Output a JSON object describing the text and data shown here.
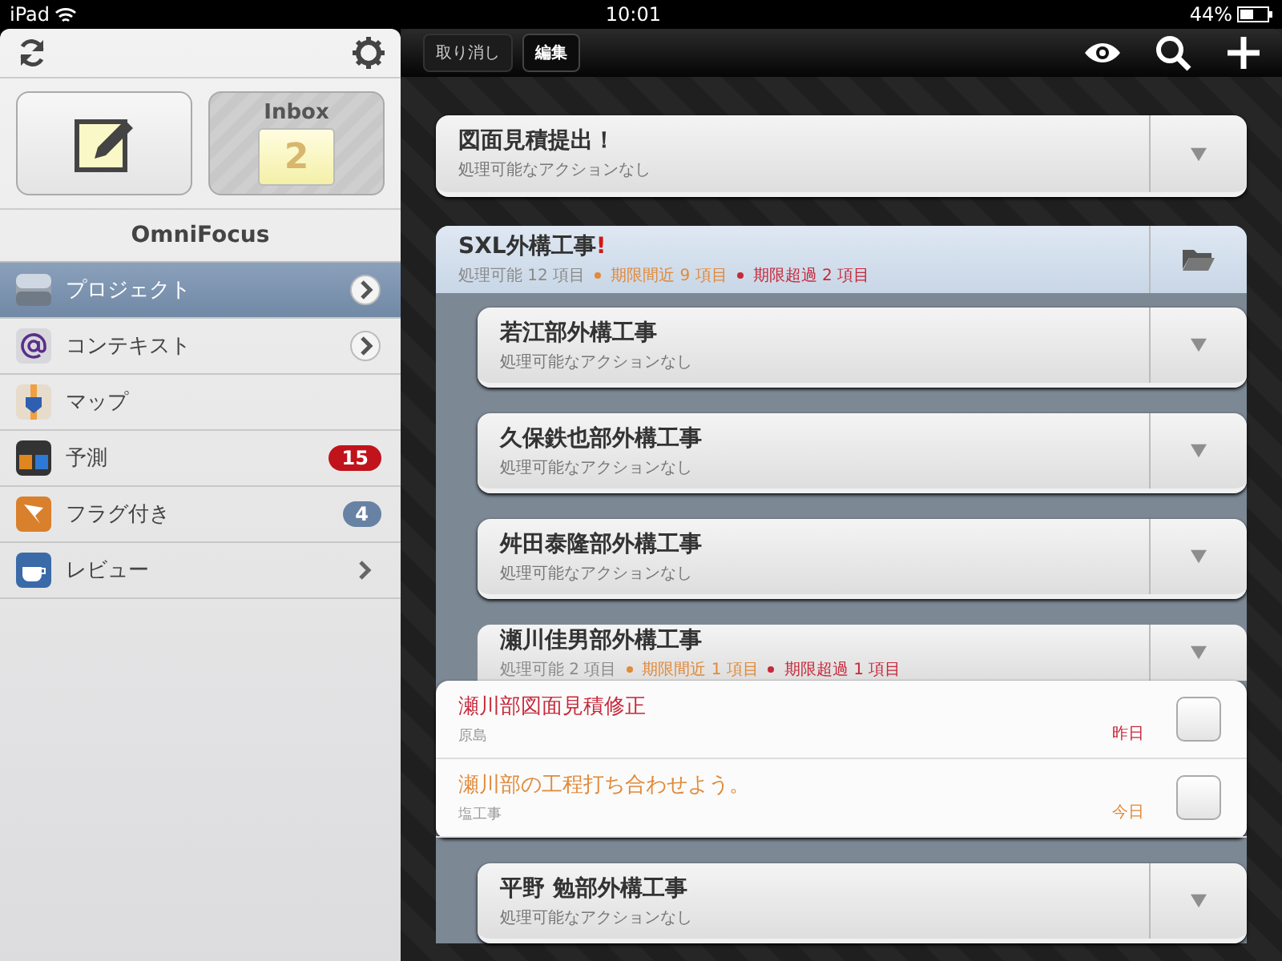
{
  "status_bar": {
    "carrier": "iPad",
    "time": "10:01",
    "battery": "44%"
  },
  "sidebar": {
    "title": "OmniFocus",
    "inbox": {
      "label": "Inbox",
      "count": "2"
    },
    "items": [
      {
        "kind": "projects",
        "label": "プロジェクト",
        "selected": true,
        "detail_button": true
      },
      {
        "kind": "contexts",
        "label": "コンテキスト",
        "selected": false,
        "detail_button": true
      },
      {
        "kind": "map",
        "label": "マップ",
        "selected": false
      },
      {
        "kind": "forecast",
        "label": "予測",
        "selected": false,
        "badge": "15",
        "color": "#c0131c"
      },
      {
        "kind": "flagged",
        "label": "フラグ付き",
        "selected": false,
        "badge": "4",
        "color": "#6882a4"
      },
      {
        "kind": "review",
        "label": "レビュー",
        "selected": false,
        "disclosure": true
      }
    ]
  },
  "toolbar": {
    "buttons": [
      {
        "label": "取り消し",
        "selected": false
      },
      {
        "label": "編集",
        "selected": true
      }
    ]
  },
  "content": [
    {
      "kind": "project",
      "title": "図面見積提出！",
      "subtitle": "処理可能なアクションなし"
    },
    {
      "kind": "folder",
      "title": "SXL外構工事",
      "priority_mark": "!",
      "meta": [
        {
          "text": "処理可能 12 項目",
          "color": "#8a8a8a"
        },
        {
          "text": "期限間近 9 項目",
          "color": "#e08a3a"
        },
        {
          "text": "期限超過 2 項目",
          "color": "#c8283a"
        }
      ],
      "children": [
        {
          "title": "若江部外構工事",
          "subtitle": "処理可能なアクションなし"
        },
        {
          "title": "久保鉄也部外構工事",
          "subtitle": "処理可能なアクションなし"
        },
        {
          "title": "舛田泰隆部外構工事",
          "subtitle": "処理可能なアクションなし"
        },
        {
          "title": "瀬川佳男部外構工事",
          "meta": [
            {
              "text": "処理可能 2 項目",
              "color": "#8a8a8a"
            },
            {
              "text": "期限間近 1 項目",
              "color": "#e08a3a"
            },
            {
              "text": "期限超過 1 項目",
              "color": "#c8283a"
            }
          ],
          "tasks": [
            {
              "title": "瀬川部図面見積修正",
              "context": "原島",
              "due": "昨日",
              "color": "#c8283a",
              "checked": false
            },
            {
              "title": "瀬川部の工程打ち合わせよう。",
              "context": "塩工事",
              "due": "今日",
              "color": "#e08a3a",
              "checked": false
            }
          ]
        },
        {
          "title": "平野 勉部外構工事",
          "subtitle": "処理可能なアクションなし"
        }
      ]
    }
  ]
}
